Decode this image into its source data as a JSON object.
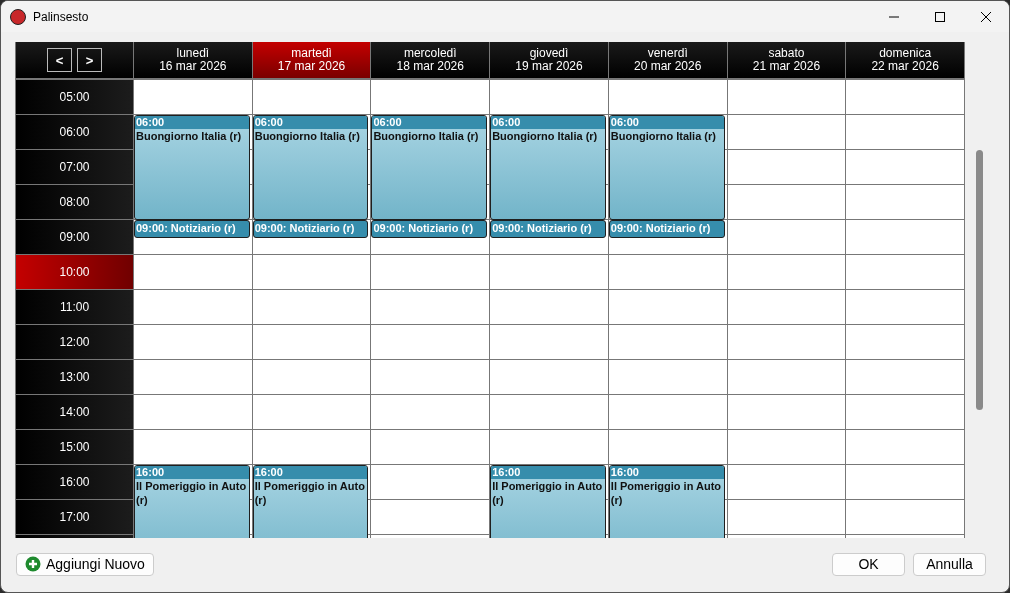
{
  "window": {
    "title": "Palinsesto"
  },
  "nav": {
    "prev": "<",
    "next": ">"
  },
  "days": [
    {
      "name": "lunedì",
      "date": "16 mar 2026",
      "selected": false,
      "events": [
        {
          "kind": "block",
          "time": "06:00",
          "title": "Buongiorno Italia (r)"
        },
        {
          "kind": "bar",
          "title": "09:00: Notiziario (r)"
        },
        {
          "kind": "block",
          "time": "16:00",
          "title": "Il Pomeriggio in Auto (r)"
        }
      ]
    },
    {
      "name": "martedì",
      "date": "17 mar 2026",
      "selected": true,
      "events": [
        {
          "kind": "block",
          "time": "06:00",
          "title": "Buongiorno Italia (r)"
        },
        {
          "kind": "bar",
          "title": "09:00: Notiziario (r)"
        },
        {
          "kind": "block",
          "time": "16:00",
          "title": "Il Pomeriggio in Auto (r)"
        }
      ]
    },
    {
      "name": "mercoledì",
      "date": "18 mar 2026",
      "selected": false,
      "events": [
        {
          "kind": "block",
          "time": "06:00",
          "title": "Buongiorno Italia (r)"
        },
        {
          "kind": "bar",
          "title": "09:00: Notiziario (r)"
        }
      ]
    },
    {
      "name": "giovedì",
      "date": "19 mar 2026",
      "selected": false,
      "events": [
        {
          "kind": "block",
          "time": "06:00",
          "title": "Buongiorno Italia (r)"
        },
        {
          "kind": "bar",
          "title": "09:00: Notiziario (r)"
        },
        {
          "kind": "block",
          "time": "16:00",
          "title": "Il Pomeriggio in Auto (r)"
        }
      ]
    },
    {
      "name": "venerdì",
      "date": "20 mar 2026",
      "selected": false,
      "events": [
        {
          "kind": "block",
          "time": "06:00",
          "title": "Buongiorno Italia (r)"
        },
        {
          "kind": "bar",
          "title": "09:00: Notiziario (r)"
        },
        {
          "kind": "block",
          "time": "16:00",
          "title": "Il Pomeriggio in Auto (r)"
        }
      ]
    },
    {
      "name": "sabato",
      "date": "21 mar 2026",
      "selected": false
    },
    {
      "name": "domenica",
      "date": "22 mar 2026",
      "selected": false
    }
  ],
  "hours": [
    {
      "label": "05:00",
      "current": false
    },
    {
      "label": "06:00",
      "current": false
    },
    {
      "label": "07:00",
      "current": false
    },
    {
      "label": "08:00",
      "current": false
    },
    {
      "label": "09:00",
      "current": false
    },
    {
      "label": "10:00",
      "current": true
    },
    {
      "label": "11:00",
      "current": false
    },
    {
      "label": "12:00",
      "current": false
    },
    {
      "label": "13:00",
      "current": false
    },
    {
      "label": "14:00",
      "current": false
    },
    {
      "label": "15:00",
      "current": false
    },
    {
      "label": "16:00",
      "current": false
    },
    {
      "label": "17:00",
      "current": false
    }
  ],
  "buttons": {
    "add": "Aggiungi Nuovo",
    "ok": "OK",
    "cancel": "Annulla"
  }
}
